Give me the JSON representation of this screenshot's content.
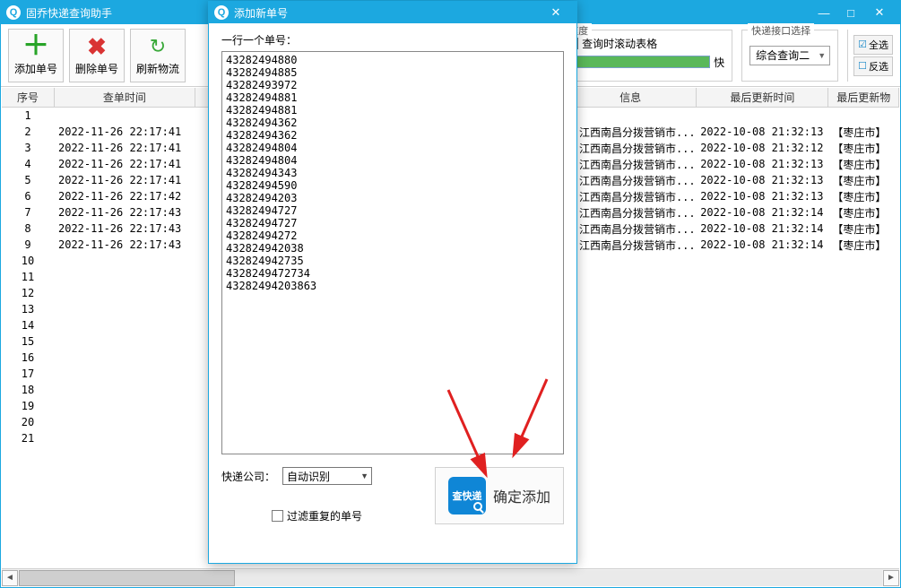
{
  "main": {
    "title": "固乔快递查询助手",
    "win_min": "—",
    "win_max": "□",
    "win_close": "✕"
  },
  "toolbar": {
    "add": "添加单号",
    "del": "删除单号",
    "refresh": "刷新物流",
    "speed_legend": "速度",
    "scroll_label": "查询时滚动表格",
    "fast_label": "快",
    "iface_legend": "快递接口选择",
    "iface_value": "综合查询二",
    "select_all": "全选",
    "invert_sel": "反选"
  },
  "columns": {
    "seq": "序号",
    "time": "查单时间",
    "info": "信息",
    "updated": "最后更新时间",
    "last": "最后更新物"
  },
  "rows": [
    {
      "seq": "1",
      "time": "",
      "info": "",
      "updated": "",
      "last": ""
    },
    {
      "seq": "2",
      "time": "2022-11-26 22:17:41",
      "info": "江西南昌分拨营销市...",
      "updated": "2022-10-08 21:32:13",
      "last": "【枣庄市】"
    },
    {
      "seq": "3",
      "time": "2022-11-26 22:17:41",
      "info": "江西南昌分拨营销市...",
      "updated": "2022-10-08 21:32:12",
      "last": "【枣庄市】"
    },
    {
      "seq": "4",
      "time": "2022-11-26 22:17:41",
      "info": "江西南昌分拨营销市...",
      "updated": "2022-10-08 21:32:13",
      "last": "【枣庄市】"
    },
    {
      "seq": "5",
      "time": "2022-11-26 22:17:41",
      "info": "江西南昌分拨营销市...",
      "updated": "2022-10-08 21:32:13",
      "last": "【枣庄市】"
    },
    {
      "seq": "6",
      "time": "2022-11-26 22:17:42",
      "info": "江西南昌分拨营销市...",
      "updated": "2022-10-08 21:32:13",
      "last": "【枣庄市】"
    },
    {
      "seq": "7",
      "time": "2022-11-26 22:17:43",
      "info": "江西南昌分拨营销市...",
      "updated": "2022-10-08 21:32:14",
      "last": "【枣庄市】"
    },
    {
      "seq": "8",
      "time": "2022-11-26 22:17:43",
      "info": "江西南昌分拨营销市...",
      "updated": "2022-10-08 21:32:14",
      "last": "【枣庄市】"
    },
    {
      "seq": "9",
      "time": "2022-11-26 22:17:43",
      "info": "江西南昌分拨营销市...",
      "updated": "2022-10-08 21:32:14",
      "last": "【枣庄市】"
    },
    {
      "seq": "10",
      "time": "",
      "info": "",
      "updated": "",
      "last": ""
    },
    {
      "seq": "11",
      "time": "",
      "info": "",
      "updated": "",
      "last": ""
    },
    {
      "seq": "12",
      "time": "",
      "info": "",
      "updated": "",
      "last": ""
    },
    {
      "seq": "13",
      "time": "",
      "info": "",
      "updated": "",
      "last": ""
    },
    {
      "seq": "14",
      "time": "",
      "info": "",
      "updated": "",
      "last": ""
    },
    {
      "seq": "15",
      "time": "",
      "info": "",
      "updated": "",
      "last": ""
    },
    {
      "seq": "16",
      "time": "",
      "info": "",
      "updated": "",
      "last": ""
    },
    {
      "seq": "17",
      "time": "",
      "info": "",
      "updated": "",
      "last": ""
    },
    {
      "seq": "18",
      "time": "",
      "info": "",
      "updated": "",
      "last": ""
    },
    {
      "seq": "19",
      "time": "",
      "info": "",
      "updated": "",
      "last": ""
    },
    {
      "seq": "20",
      "time": "",
      "info": "",
      "updated": "",
      "last": ""
    },
    {
      "seq": "21",
      "time": "",
      "info": "",
      "updated": "",
      "last": ""
    }
  ],
  "dialog": {
    "title": "添加新单号",
    "close": "✕",
    "line_label": "一行一个单号：",
    "tracking_text": "43282494880\n43282494885\n43282493972\n43282494881\n43282494881\n43282494362\n43282494362\n43282494804\n43282494804\n43282494343\n43282494590\n43282494203\n43282494727\n43282494727\n43282494272\n432824942038\n432824942735\n4328249472734\n43282494203863",
    "company_label": "快递公司：",
    "company_value": "自动识别",
    "filter_label": "过滤重复的单号",
    "confirm_icon_text": "查快递",
    "confirm_label": "确定添加"
  }
}
